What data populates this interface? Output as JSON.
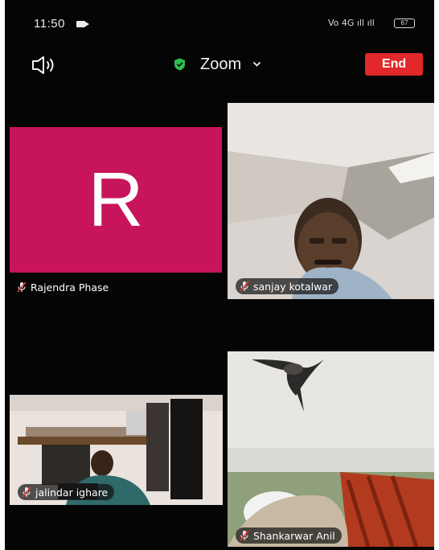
{
  "status_bar": {
    "time": "11:50",
    "signal_text": "Vo  4G  ıll  ıll"
  },
  "top_bar": {
    "speaker_icon": "speaker-icon",
    "security_icon": "green-shield-icon",
    "meeting_title": "Zoom",
    "end_label": "End",
    "colors": {
      "end_button": "#e3282b",
      "shield": "#2fbf4f"
    }
  },
  "participants": [
    {
      "name": "Rajendra Phase",
      "avatar_letter": "R",
      "video": false,
      "avatar_color": "#c8145a"
    },
    {
      "name": "sanjay kotalwar",
      "video": true
    },
    {
      "name": "jalindar ighare",
      "video": true
    },
    {
      "name": "Shankarwar Anil",
      "video": true
    }
  ]
}
